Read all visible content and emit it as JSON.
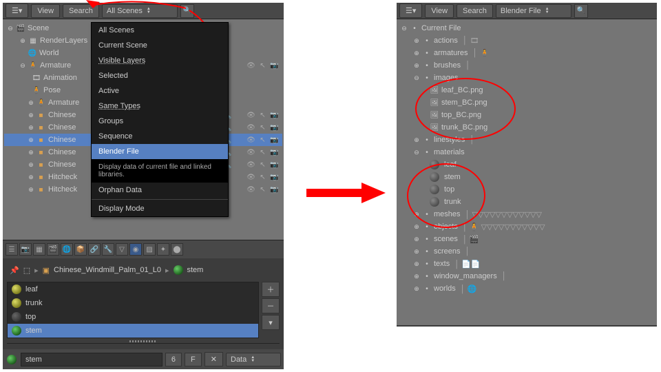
{
  "header": {
    "view": "View",
    "search": "Search",
    "filterLeft": "All Scenes",
    "filterRight": "Blender File"
  },
  "dropdown": {
    "items": [
      "All Scenes",
      "Current Scene",
      "Visible Layers",
      "Selected",
      "Active",
      "Same Types",
      "Groups",
      "Sequence",
      "Blender File"
    ],
    "highlight": "Blender File",
    "tooltip": "Display data of current file and linked libraries.",
    "tail": [
      "Orphan Data",
      "Display Mode"
    ]
  },
  "leftTree": {
    "scene": "Scene",
    "rl": "RenderLayers",
    "world": "World",
    "arm": "Armature",
    "ani": "Animation",
    "pose": "Pose",
    "armdata": "Armature",
    "chinese": [
      "Chinese",
      "Chinese",
      "Chinese",
      "Chinese",
      "Chinese"
    ],
    "hitch": [
      "Hitcheck",
      "Hitcheck"
    ]
  },
  "bread": {
    "obj": "Chinese_Windmill_Palm_01_L0",
    "mat": "stem"
  },
  "mats": [
    "leaf",
    "trunk",
    "top",
    "stem"
  ],
  "footer": {
    "name": "stem",
    "num": "6",
    "f": "F",
    "data": "Data"
  },
  "rightTree": {
    "root": "Current File",
    "cats": [
      "actions",
      "armatures",
      "brushes",
      "images",
      "linestyles",
      "materials",
      "meshes",
      "objects",
      "scenes",
      "screens",
      "texts",
      "window_managers",
      "worlds"
    ],
    "images": [
      "leaf_BC.png",
      "stem_BC.png",
      "top_BC.png",
      "trunk_BC.png"
    ],
    "materials": [
      "leaf",
      "stem",
      "top",
      "trunk"
    ]
  },
  "glyphs": {
    "wrench": "🔧",
    "eye": "👁",
    "cursor": "↖",
    "cam": "📷",
    "mesh": "◆",
    "dot": "•",
    "plus": "⊕",
    "minus": "⊖",
    "tri": "▽",
    "file": "📄",
    "ball": "◉",
    "human": "🧍"
  }
}
